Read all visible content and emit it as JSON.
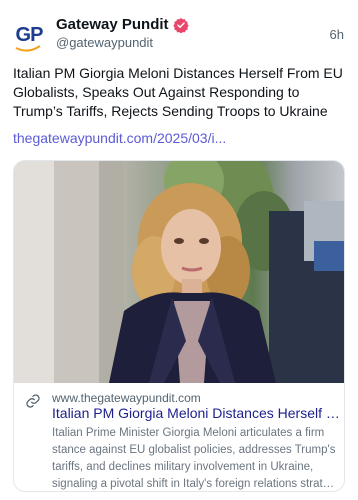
{
  "author": {
    "avatar_text": "GP",
    "display_name": "Gateway Pundit",
    "handle": "@gatewaypundit",
    "verified_icon": "verified-badge-icon",
    "time": "6h"
  },
  "post": {
    "text": "Italian PM Giorgia Meloni Distances Herself From EU Globalists, Speaks Out Against Responding to Trump’s Tariffs, Rejects Sending Troops to Ukraine",
    "link": "thegatewaypundit.com/2025/03/i..."
  },
  "card": {
    "domain": "www.thegatewaypundit.com",
    "title": "Italian PM Giorgia Meloni Distances Herself Fro…",
    "description": "Italian Prime Minister Giorgia Meloni articulates a firm stance against EU globalist policies, addresses Trump's tariffs, and declines military involvement in Ukraine, signaling a pivotal shift in Italy's foreign relations strat…",
    "link_icon": "link-icon"
  },
  "colors": {
    "brand_blue": "#1d3c8f",
    "verified_pink": "#e8466b",
    "link_purple": "#5b5bd6",
    "card_title": "#1d1f8c"
  }
}
